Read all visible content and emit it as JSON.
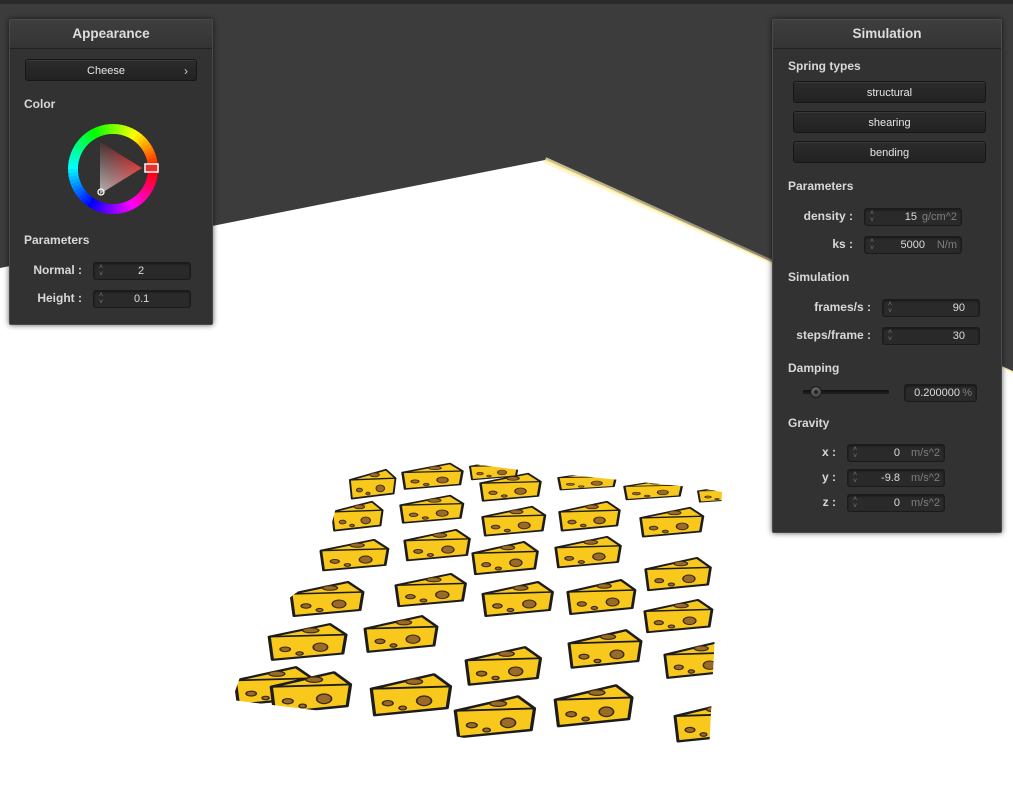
{
  "appearance": {
    "title": "Appearance",
    "shader_button": "Cheese",
    "color_label": "Color",
    "wheel_icon": "color-wheel",
    "parameters_label": "Parameters",
    "normal_label": "Normal :",
    "normal_value": "2",
    "height_label": "Height :",
    "height_value": "0.1"
  },
  "simulation": {
    "title": "Simulation",
    "spring_types_label": "Spring types",
    "spring_buttons": [
      "structural",
      "shearing",
      "bending"
    ],
    "parameters_label": "Parameters",
    "density_label": "density :",
    "density_value": "15",
    "density_unit": "g/cm^2",
    "ks_label": "ks :",
    "ks_value": "5000",
    "ks_unit": "N/m",
    "simulation_label": "Simulation",
    "fps_label": "frames/s :",
    "fps_value": "90",
    "steps_label": "steps/frame :",
    "steps_value": "30",
    "damping_label": "Damping",
    "damping_fraction": 0.2,
    "damping_value": "0.200000",
    "damping_unit": "%",
    "gravity_label": "Gravity",
    "gx_label": "x :",
    "gx_value": "0",
    "gy_label": "y :",
    "gy_value": "-9.8",
    "gz_label": "z :",
    "gz_value": "0",
    "gravity_unit": "m/s^2"
  },
  "colors": {
    "background_dark": "#3c3c3c",
    "cheese_yellow": "#f8c81c",
    "cheese_hole": "#9a6a28",
    "wheel_marker": "#e83030"
  }
}
